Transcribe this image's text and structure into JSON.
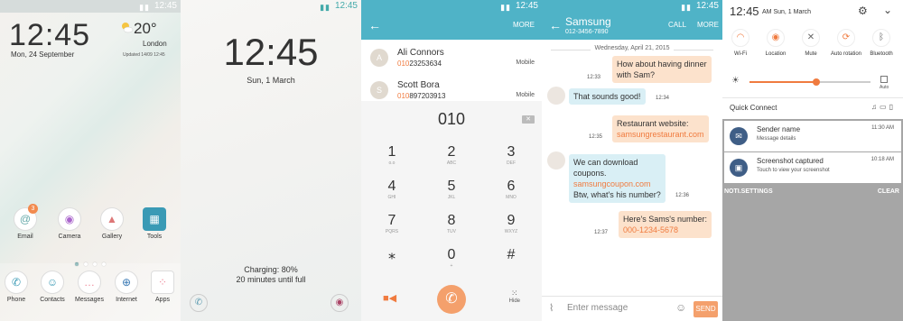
{
  "colors": {
    "accent": "#4fb3c7",
    "orange": "#f07b3f"
  },
  "home": {
    "status_time": "12:45",
    "clock": "12:45",
    "date": "Mon, 24 September",
    "temp": "20°",
    "location": "London",
    "updated": "Updated 14/09 12:45",
    "badge": "3",
    "apps": [
      {
        "label": "Email",
        "icon": "email-icon",
        "glyph": "@"
      },
      {
        "label": "Camera",
        "icon": "camera-icon",
        "glyph": "◉"
      },
      {
        "label": "Gallery",
        "icon": "gallery-icon",
        "glyph": "▲"
      },
      {
        "label": "Tools",
        "icon": "tools-icon",
        "glyph": "▦"
      }
    ],
    "dock": [
      {
        "label": "Phone",
        "icon": "phone-icon",
        "glyph": "✆"
      },
      {
        "label": "Contacts",
        "icon": "contacts-icon",
        "glyph": "☺"
      },
      {
        "label": "Messages",
        "icon": "messages-icon",
        "glyph": "…"
      },
      {
        "label": "Internet",
        "icon": "globe-icon",
        "glyph": "⊕"
      },
      {
        "label": "Apps",
        "icon": "apps-icon",
        "glyph": "⁘"
      }
    ]
  },
  "lock": {
    "status_time": "12:45",
    "clock": "12:45",
    "date": "Sun, 1 March",
    "charge1": "Charging: 80%",
    "charge2": "20 minutes until full"
  },
  "dialer": {
    "status_time": "12:45",
    "more": "MORE",
    "contacts": [
      {
        "initial": "A",
        "name": "Ali Connors",
        "match": "010",
        "rest": "23253634",
        "type": "Mobile"
      },
      {
        "initial": "S",
        "name": "Scott Bora",
        "match": "010",
        "rest": "897203913",
        "type": "Mobile"
      }
    ],
    "entry": "010",
    "keys": [
      {
        "d": "1",
        "l": "o.o"
      },
      {
        "d": "2",
        "l": "ABC"
      },
      {
        "d": "3",
        "l": "DEF"
      },
      {
        "d": "4",
        "l": "GHI"
      },
      {
        "d": "5",
        "l": "JKL"
      },
      {
        "d": "6",
        "l": "MNO"
      },
      {
        "d": "7",
        "l": "PQRS"
      },
      {
        "d": "8",
        "l": "TUV"
      },
      {
        "d": "9",
        "l": "WXYZ"
      },
      {
        "d": "⁎",
        "l": ""
      },
      {
        "d": "0",
        "l": "+"
      },
      {
        "d": "#",
        "l": ""
      }
    ],
    "hide": "Hide"
  },
  "messages": {
    "status_time": "12:45",
    "title": "Samsung",
    "number": "012-3456-7890",
    "call": "CALL",
    "more": "MORE",
    "day": "Wednesday, April 21, 2015",
    "m1a": "How about having dinner",
    "m1b": "with Sam?",
    "t1": "12:33",
    "m2": "That sounds good!",
    "t2": "12:34",
    "m3a": "Restaurant website:",
    "m3b": "samsungrestaurant.com",
    "t3": "12:35",
    "m4a": "We can download",
    "m4b": "coupons.",
    "m4c": "samsungcoupon.com",
    "m4d": "Btw, what's his number?",
    "t4": "12:36",
    "m5a": "Here's Sams's number:",
    "m5b": "000-1234-5678",
    "t5": "12:37",
    "placeholder": "Enter message",
    "send": "SEND"
  },
  "notif": {
    "clock": "12:45",
    "date": "AM Sun, 1 March",
    "toggles": [
      {
        "label": "Wi-Fi",
        "icon": "wifi-icon",
        "glyph": "◠",
        "on": true
      },
      {
        "label": "Location",
        "icon": "location-icon",
        "glyph": "◉",
        "on": true
      },
      {
        "label": "Mute",
        "icon": "mute-icon",
        "glyph": "✕",
        "on": false
      },
      {
        "label": "Auto rotation",
        "icon": "rotation-icon",
        "glyph": "⟳",
        "on": true
      },
      {
        "label": "Bluetooth",
        "icon": "bluetooth-icon",
        "glyph": "ᛒ",
        "on": false
      }
    ],
    "brightness": 0.55,
    "auto": "Auto",
    "quick_connect": "Quick Connect",
    "items": [
      {
        "title": "Sender name",
        "sub": "Message details",
        "time": "11:30 AM",
        "glyph": "✉"
      },
      {
        "title": "Screenshot captured",
        "sub": "Touch to view your screenshot",
        "time": "10:18 AM",
        "glyph": "▣"
      }
    ],
    "settings": "NOTI.SETTINGS",
    "clear": "CLEAR"
  }
}
